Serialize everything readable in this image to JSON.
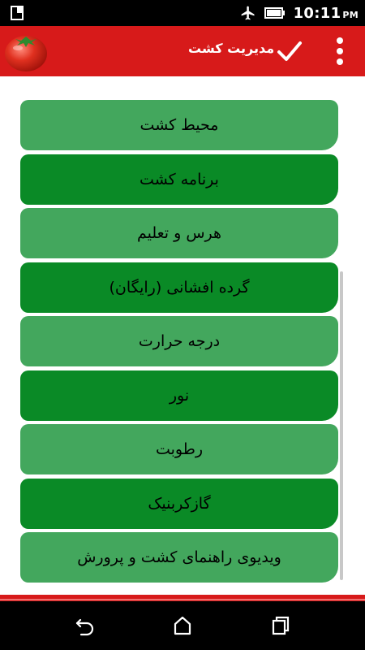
{
  "status_bar": {
    "time": "10:11",
    "ampm": "PM",
    "icons": [
      "sim-card-icon",
      "airplane-icon",
      "battery-icon"
    ]
  },
  "app_bar": {
    "title": "مدیریت کشت",
    "background": "#d71a1a",
    "icons": [
      "tomato-logo-icon",
      "check-icon",
      "overflow-menu-icon"
    ]
  },
  "menu": {
    "items": [
      {
        "label": "محیط کشت",
        "style": "light"
      },
      {
        "label": "برنامه کشت",
        "style": "dark"
      },
      {
        "label": "هرس و تعلیم",
        "style": "light"
      },
      {
        "label": "گرده افشانی (رایگان)",
        "style": "dark"
      },
      {
        "label": "درجه حرارت",
        "style": "light"
      },
      {
        "label": "نور",
        "style": "dark"
      },
      {
        "label": "رطوبت",
        "style": "light"
      },
      {
        "label": "گازکربنیک",
        "style": "dark"
      },
      {
        "label": "ویدیوی راهنمای کشت و پرورش",
        "style": "light"
      }
    ],
    "colors": {
      "light": "#43a75d",
      "dark": "#0a8a26"
    }
  },
  "nav_bar": {
    "icons": [
      "back-icon",
      "home-icon",
      "recent-apps-icon"
    ]
  }
}
